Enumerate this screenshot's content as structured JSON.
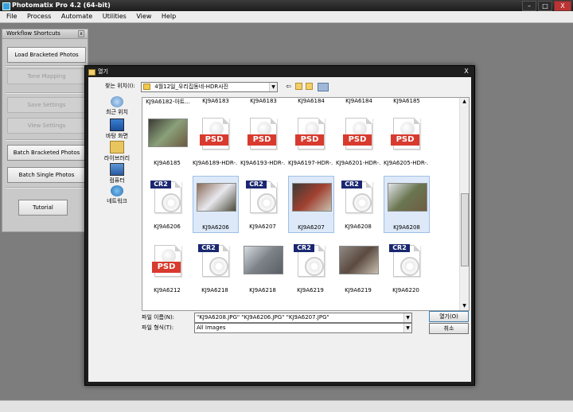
{
  "app": {
    "title": "Photomatix Pro 4.2 (64-bit)",
    "window_controls": [
      "–",
      "□",
      "X"
    ]
  },
  "menu": [
    "File",
    "Process",
    "Automate",
    "Utilities",
    "View",
    "Help"
  ],
  "workflow": {
    "title": "Workflow Shortcuts",
    "close": "x",
    "buttons": {
      "load_bracketed": "Load Bracketed Photos",
      "tone_mapping": "Tone Mapping",
      "save_settings": "Save Settings",
      "view_settings": "View Settings",
      "batch_bracketed": "Batch Bracketed Photos",
      "batch_single": "Batch Single Photos",
      "tutorial": "Tutorial"
    }
  },
  "dialog": {
    "title": "열기",
    "close": "X",
    "look_in_label": "찾는 위치(I):",
    "look_in_value": "4월12일_우리집동네-HDR사진",
    "places": [
      "최근 위치",
      "바탕 화면",
      "라이브러리",
      "컴퓨터",
      "네트워크"
    ],
    "top_row": [
      "KJ9A6182-아트...",
      "KJ9A6183",
      "KJ9A6183",
      "KJ9A6184",
      "KJ9A6184",
      "KJ9A6185"
    ],
    "files": [
      {
        "name": "KJ9A6185",
        "kind": "photo",
        "selected": false
      },
      {
        "name": "KJ9A6189-HDR-...",
        "kind": "psd",
        "selected": false
      },
      {
        "name": "KJ9A6193-HDR-...",
        "kind": "psd",
        "selected": false
      },
      {
        "name": "KJ9A6197-HDR-...",
        "kind": "psd",
        "selected": false
      },
      {
        "name": "KJ9A6201-HDR-...",
        "kind": "psd",
        "selected": false
      },
      {
        "name": "KJ9A6205-HDR-...",
        "kind": "psd",
        "selected": false
      },
      {
        "name": "KJ9A6206",
        "kind": "cr2",
        "selected": false
      },
      {
        "name": "KJ9A6206",
        "kind": "photo",
        "selected": true
      },
      {
        "name": "KJ9A6207",
        "kind": "cr2",
        "selected": false
      },
      {
        "name": "KJ9A6207",
        "kind": "photo",
        "selected": true
      },
      {
        "name": "KJ9A6208",
        "kind": "cr2",
        "selected": false
      },
      {
        "name": "KJ9A6208",
        "kind": "photo",
        "selected": true
      },
      {
        "name": "KJ9A6212",
        "kind": "psd",
        "selected": false
      },
      {
        "name": "KJ9A6218",
        "kind": "cr2",
        "selected": false
      },
      {
        "name": "KJ9A6218",
        "kind": "photo",
        "selected": false
      },
      {
        "name": "KJ9A6219",
        "kind": "cr2",
        "selected": false
      },
      {
        "name": "KJ9A6219",
        "kind": "photo",
        "selected": false
      },
      {
        "name": "KJ9A6220",
        "kind": "cr2",
        "selected": false
      }
    ],
    "filename_label": "파일 이름(N):",
    "filename_value": "\"KJ9A6208.JPG\" \"KJ9A6206.JPG\" \"KJ9A6207.JPG\"",
    "filetype_label": "파일 형식(T):",
    "filetype_value": "All Images",
    "open_button": "열기(O)",
    "cancel_button": "취소",
    "badges": {
      "psd": "PSD",
      "cr2": "CR2"
    }
  }
}
